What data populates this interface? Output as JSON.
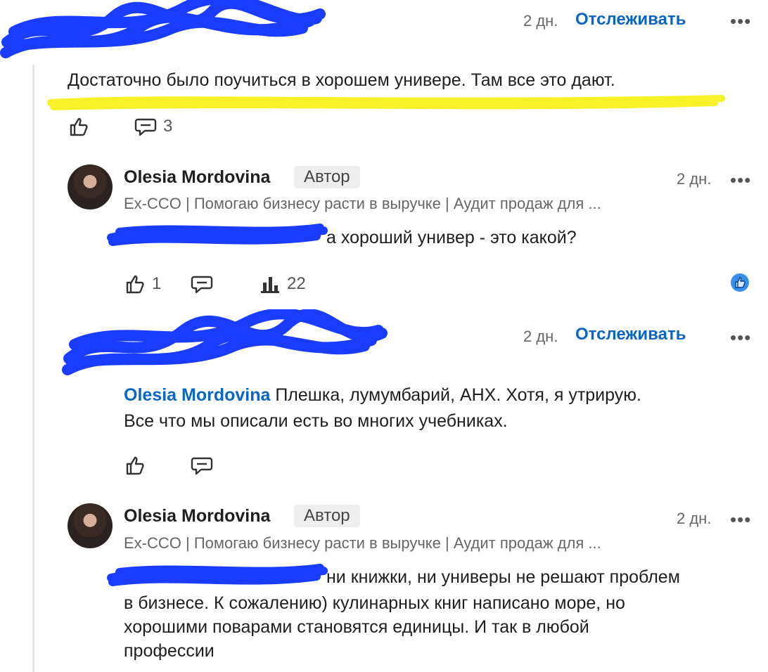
{
  "comments": [
    {
      "time": "2 дн.",
      "follow": "Отслеживать",
      "text": "Достаточно было поучиться в хорошем универе. Там все это дают.",
      "replies_count": "3"
    },
    {
      "author": "Olesia Mordovina",
      "badge": "Автор",
      "headline": "Ex-CCO | Помогаю бизнесу расти в выручке | Аудит продаж для ...",
      "time": "2 дн.",
      "text": "а хороший универ - это какой?",
      "likes": "1",
      "impressions": "22"
    },
    {
      "time": "2 дн.",
      "follow": "Отслеживать",
      "mention": "Olesia Mordovina",
      "text_line1": " Плешка, лумумбарий, АНХ. Хотя, я утрирую.",
      "text_line2": "Все что мы описали есть во многих учебниках."
    },
    {
      "author": "Olesia Mordovina",
      "badge": "Автор",
      "headline": "Ex-CCO | Помогаю бизнесу расти в выручке | Аудит продаж для ...",
      "time": "2 дн.",
      "text_line1": "ни книжки, ни универы не решают проблем",
      "text_line2": "в бизнесе. К сожалению) кулинарных книг написано море, но",
      "text_line3": "хорошими поварами становятся единицы. И так в любой",
      "text_line4": "профессии"
    }
  ],
  "icons": {
    "like": "like-icon",
    "comment": "comment-icon",
    "analytics": "analytics-icon",
    "more": "more-icon",
    "reaction": "like-reaction-icon"
  },
  "colors": {
    "link": "#0a66c2",
    "scribble_blue": "#1a3cff",
    "highlight_yellow": "#f7f227"
  }
}
